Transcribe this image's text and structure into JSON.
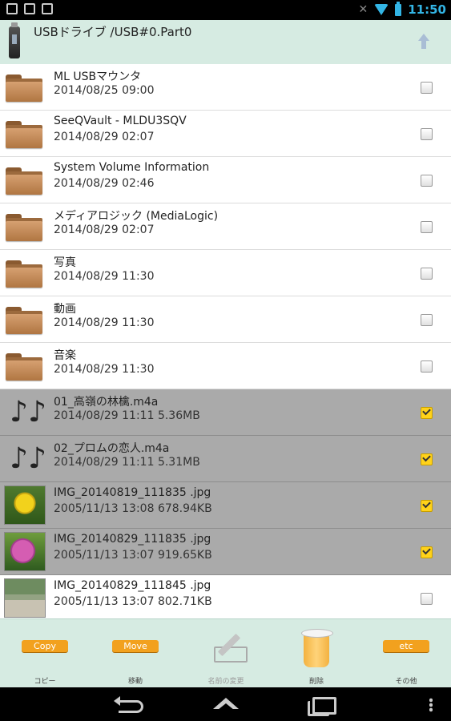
{
  "status_bar": {
    "time": "11:50"
  },
  "header": {
    "title": "USBドライブ /USB#0.Part0"
  },
  "files": [
    {
      "name": "ML USBマウンタ",
      "meta": "2014/08/25 09:00",
      "type": "folder",
      "selected": false
    },
    {
      "name": "SeeQVault - MLDU3SQV",
      "meta": "2014/08/29 02:07",
      "type": "folder",
      "selected": false
    },
    {
      "name": "System Volume Information",
      "meta": "2014/08/29 02:46",
      "type": "folder",
      "selected": false
    },
    {
      "name": "メディアロジック (MediaLogic)",
      "meta": "2014/08/29 02:07",
      "type": "folder",
      "selected": false
    },
    {
      "name": "写真",
      "meta": "2014/08/29 11:30",
      "type": "folder",
      "selected": false
    },
    {
      "name": "動画",
      "meta": "2014/08/29 11:30",
      "type": "folder",
      "selected": false
    },
    {
      "name": "音楽",
      "meta": "2014/08/29 11:30",
      "type": "folder",
      "selected": false
    },
    {
      "name": "01_高嶺の林檎.m4a",
      "meta": "2014/08/29 11:11 5.36MB",
      "type": "audio",
      "selected": true
    },
    {
      "name": "02_プロムの恋人.m4a",
      "meta": "2014/08/29 11:11 5.31MB",
      "type": "audio",
      "selected": true
    },
    {
      "name": "IMG_20140819_111835 .jpg",
      "meta": "2005/11/13 13:08 678.94KB",
      "type": "image",
      "selected": true
    },
    {
      "name": "IMG_20140829_111835 .jpg",
      "meta": "2005/11/13 13:07 919.65KB",
      "type": "image",
      "selected": true
    },
    {
      "name": "IMG_20140829_111845 .jpg",
      "meta": "2005/11/13 13:07 802.71KB",
      "type": "image",
      "selected": false
    }
  ],
  "toolbar": {
    "copy_badge": "Copy",
    "copy_label": "コピー",
    "move_badge": "Move",
    "move_label": "移動",
    "rename_label": "名前の変更",
    "delete_label": "削除",
    "etc_badge": "etc",
    "etc_label": "その他"
  },
  "icons": {
    "folder": "folder-icon",
    "audio": "music-note-icon",
    "image": "image-thumbnail",
    "up": "up-arrow-icon",
    "drive": "usb-drive-icon",
    "delete": "trash-icon",
    "rename": "rename-pencil-icon"
  },
  "colors": {
    "header_bg": "#d6ebe2",
    "selected_row": "#aaaaaa",
    "badge": "#f2a11e",
    "accent": "#33b5e5"
  }
}
